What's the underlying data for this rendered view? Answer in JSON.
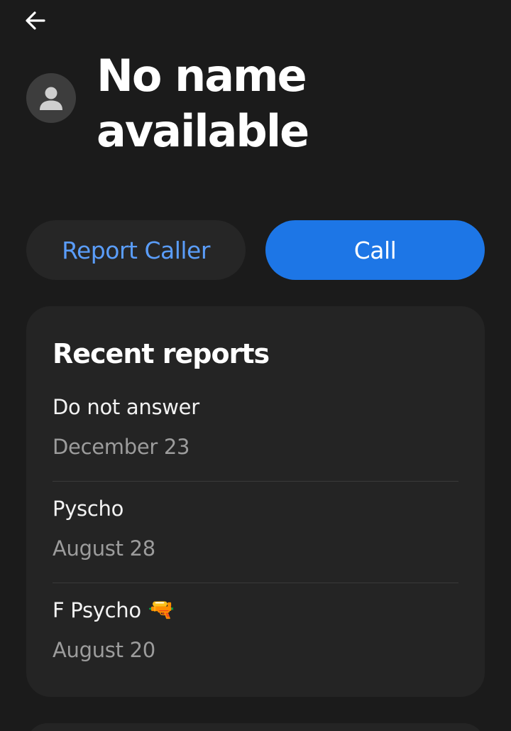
{
  "header": {
    "back_icon": "arrow-left-icon"
  },
  "caller": {
    "avatar_icon": "person-icon",
    "name": "No name available"
  },
  "actions": {
    "report_label": "Report Caller",
    "call_label": "Call",
    "colors": {
      "accent": "#1d76e6",
      "link": "#5a9dfa"
    }
  },
  "reports": {
    "title": "Recent reports",
    "items": [
      {
        "label": "Do not answer",
        "date": "December 23"
      },
      {
        "label": "Pyscho",
        "date": "August 28"
      },
      {
        "label": "F Psycho",
        "emoji": "🔫",
        "date": "August 20"
      }
    ]
  }
}
